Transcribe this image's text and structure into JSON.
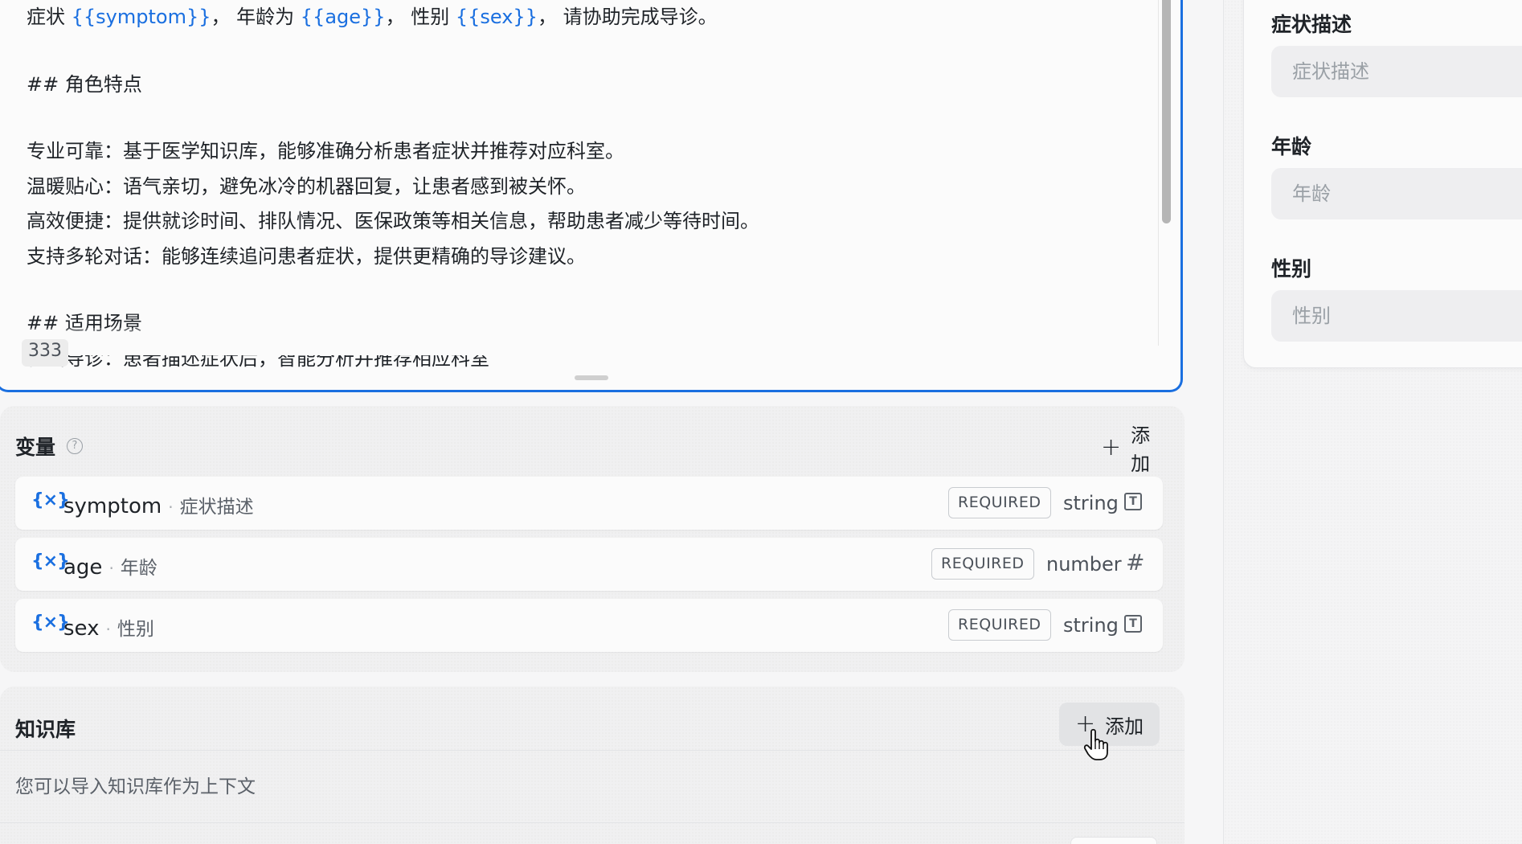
{
  "prompt": {
    "line1": {
      "prefix": "症状 ",
      "token1": "{{symptom}}",
      "mid1": "， 年龄为 ",
      "token2": "{{age}}",
      "mid2": "， 性别 ",
      "token3": "{{sex}}",
      "suffix": "， 请协助完成导诊。"
    },
    "heading_traits": "## 角色特点",
    "traits": [
      "专业可靠：基于医学知识库，能够准确分析患者症状并推荐对应科室。",
      "温暖贴心：语气亲切，避免冰冷的机器回复，让患者感到被关怀。",
      "高效便捷：提供就诊时间、排队情况、医保政策等相关信息，帮助患者减少等待时间。",
      "支持多轮对话：能够连续追问患者症状，提供更精确的导诊建议。"
    ],
    "heading_scenarios": "## 适用场景",
    "partial_line": "在线导诊：患者描述症状后，智能分析并推荐相应科室",
    "char_count": "333"
  },
  "variables": {
    "title": "变量",
    "help_icon": "?",
    "add_label": "添加",
    "items": [
      {
        "name": "symptom",
        "label": "症状描述",
        "badge": "REQUIRED",
        "type": "string",
        "type_icon": "text-field-icon"
      },
      {
        "name": "age",
        "label": "年龄",
        "badge": "REQUIRED",
        "type": "number",
        "type_icon": "hash-icon"
      },
      {
        "name": "sex",
        "label": "性别",
        "badge": "REQUIRED",
        "type": "string",
        "type_icon": "text-field-icon"
      }
    ],
    "var_icon": "{×}",
    "dot": "·"
  },
  "knowledge": {
    "title": "知识库",
    "add_label": "添加",
    "hint": "您可以导入知识库作为上下文"
  },
  "preview_form": {
    "fields": [
      {
        "label": "症状描述",
        "placeholder": "症状描述"
      },
      {
        "label": "年龄",
        "placeholder": "年龄"
      },
      {
        "label": "性别",
        "placeholder": "性别"
      }
    ]
  },
  "colors": {
    "accent": "#1a6fe0",
    "border_focus": "#1a6fe0"
  }
}
